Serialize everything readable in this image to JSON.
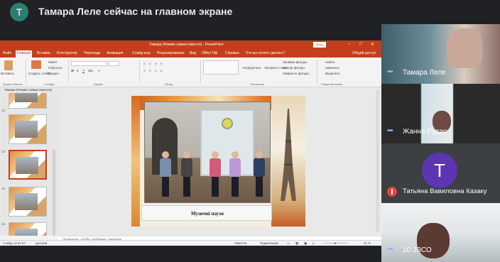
{
  "header": {
    "presenter_initial": "Т",
    "presenting_text": "Тамара Леле сейчас на главном экране"
  },
  "powerpoint": {
    "window_title": "Тамара (Режим совместимости) - PowerPoint",
    "sign_in": "Вход",
    "tabs": [
      "Файл",
      "Главная",
      "Вставка",
      "Конструктор",
      "Переходы",
      "Анимация",
      "Слайд-шоу",
      "Рецензирование",
      "Вид",
      "Office Tab",
      "Справка",
      "Что вы хотите сделать?"
    ],
    "share": "Общий доступ",
    "ribbon": {
      "paste": "Вставить",
      "new_slide": "Создать слайд",
      "layout": "Макет",
      "reset": "Сбросить",
      "section": "Раздел",
      "group_clipboard": "Буфер обмена",
      "group_slides": "Слайды",
      "group_font": "Шрифт",
      "group_paragraph": "Абзац",
      "group_drawing": "Рисование",
      "arrange": "Упорядочить",
      "quick_styles": "Экспресс-стили",
      "shape_fill": "Заливка фигуры",
      "shape_outline": "Контур фигуры",
      "shape_effects": "Эффекты фигуры",
      "find": "Найти",
      "replace": "Заменить",
      "select": "Выделить",
      "group_editing": "Редактирование"
    },
    "panel_header": "Тамара (Режим совместимости)",
    "slide_numbers": [
      "12",
      "13",
      "14",
      "15"
    ],
    "slide_caption": "Музичні паузи",
    "notes_placeholder": "Щелкните, чтобы добавить заметки",
    "status": {
      "slide": "Слайд 13 из 97",
      "language": "русский",
      "notes": "Заметки",
      "comments": "Примечания",
      "zoom": "41 %"
    }
  },
  "participants": [
    {
      "name": "Тамара Леле",
      "speaking": true
    },
    {
      "name": "Жанна Рудас",
      "speaking": true
    },
    {
      "name": "Татьяна Вавиловна Казаку",
      "initial": "Т",
      "muted": true
    },
    {
      "name": "10 ЗЗСО",
      "speaking": true
    }
  ],
  "colors": {
    "ppt_accent": "#c43e1c",
    "meet_dark": "#202124",
    "speaking_dots": "#8ab4f8",
    "mute_red": "#ea4335",
    "avatar_purple": "#5e35b1",
    "avatar_teal": "#2e7d72"
  }
}
